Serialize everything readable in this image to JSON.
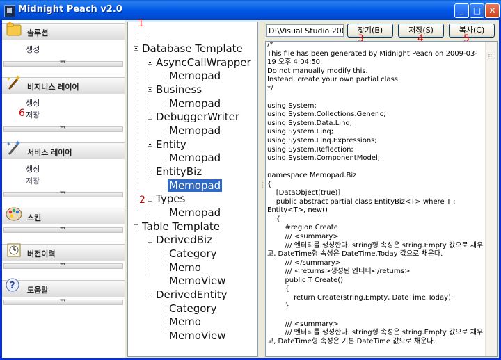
{
  "window": {
    "title": "Midnight Peach v2.0"
  },
  "nav": {
    "sections": [
      {
        "label": "솔루션",
        "icon": "folder-star-icon",
        "items": [
          "생성"
        ]
      },
      {
        "label": "비지니스 레이어",
        "icon": "magic-wand-icon",
        "items": [
          "생성",
          "저장"
        ]
      },
      {
        "label": "서비스 레이어",
        "icon": "magic-wand-sparkle-icon",
        "items": [
          "생성",
          "저장"
        ]
      },
      {
        "label": "스킨",
        "icon": "palette-icon",
        "items": []
      },
      {
        "label": "버전이력",
        "icon": "clock-icon",
        "items": []
      },
      {
        "label": "도움말",
        "icon": "help-icon",
        "items": []
      }
    ]
  },
  "tree": {
    "nodes": [
      "Database Template",
      "AsyncCallWrapper",
      "Memopad",
      "Business",
      "Memopad",
      "DebuggerWriter",
      "Memopad",
      "Entity",
      "Memopad",
      "EntityBiz",
      "Memopad",
      "Types",
      "Memopad",
      "Table Template",
      "DerivedBiz",
      "Category",
      "Memo",
      "MemoView",
      "DerivedEntity",
      "Category",
      "Memo",
      "MemoView"
    ],
    "selected_index": 10
  },
  "toolbar": {
    "path": "D:\\Visual Studio 200",
    "find_label": "찾기(B)",
    "save_label": "저장(S)",
    "copy_label": "복사(C)"
  },
  "annotations": [
    "1",
    "2",
    "3",
    "4",
    "5",
    "6"
  ],
  "code": "/*\nThis file has been generated by Midnight Peach on 2009-03-19 오후 4:04:50.\nDo not manually modify this.\nInstead, create your own partial class.\n*/\n\nusing System;\nusing System.Collections.Generic;\nusing System.Data.Linq;\nusing System.Linq;\nusing System.Linq.Expressions;\nusing System.Reflection;\nusing System.ComponentModel;\n\nnamespace Memopad.Biz\n{\n    [DataObject(true)]\n    public abstract partial class EntityBiz<T> where T : Entity<T>, new()\n    {\n        #region Create\n        /// <summary>\n        /// 엔터티를 생성한다. string형 속성은 string.Empty 값으로 채우고, DateTime형 속성은 DateTime.Today 값으로 채운다.\n        /// </summary>\n        /// <returns>생성된 엔터티</returns>\n        public T Create()\n        {\n            return Create(string.Empty, DateTime.Today);\n        }\n\n        /// <summary>\n        /// 엔터티를 생성한다. string형 속성은 string.Empty 값으로 채우고, DateTime형 속성은 기본 DateTime 값으로 채운다."
}
